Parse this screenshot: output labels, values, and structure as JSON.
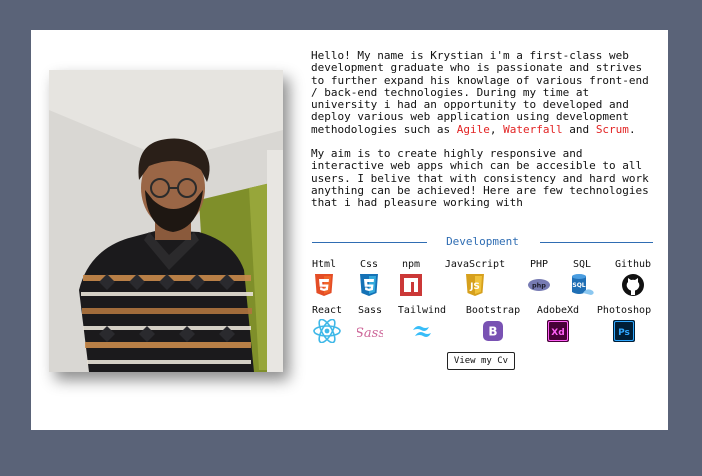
{
  "bio": {
    "p1_pre": "Hello! My name is Krystian i'm a first-class web development graduate who is passionate and strives to further expand his knowlage of various front-end / back-end technologies. During my time at university i had an opportunity to developed and deploy various web application using development methodologies such as ",
    "method1": "Agile",
    "sep1": ", ",
    "method2": "Waterfall",
    "sep2": " and ",
    "method3": "Scrum",
    "end": ".",
    "p2": "My aim is to create highly responsive and interactive web apps which can be accesible to all users. I belive that with consistency and hard work anything can be achieved! Here are few technologies that i had pleasure working with"
  },
  "section_title": "Development",
  "tech": [
    {
      "label": "Html",
      "icon": "html5-icon"
    },
    {
      "label": "Css",
      "icon": "css3-icon"
    },
    {
      "label": "npm",
      "icon": "npm-icon"
    },
    {
      "label": "JavaScript",
      "icon": "javascript-icon"
    },
    {
      "label": "PHP",
      "icon": "php-icon"
    },
    {
      "label": "SQL",
      "icon": "sql-icon"
    },
    {
      "label": "Github",
      "icon": "github-icon"
    },
    {
      "label": "React",
      "icon": "react-icon"
    },
    {
      "label": "Sass",
      "icon": "sass-icon"
    },
    {
      "label": "Tailwind",
      "icon": "tailwind-icon"
    },
    {
      "label": "Bootstrap",
      "icon": "bootstrap-icon"
    },
    {
      "label": "AdobeXd",
      "icon": "adobe-xd-icon"
    },
    {
      "label": "Photoshop",
      "icon": "photoshop-icon"
    }
  ],
  "cv_button": "View my Cv",
  "colors": {
    "background": "#5a6378",
    "highlight": "#e22323",
    "accent": "#2f6db3"
  }
}
